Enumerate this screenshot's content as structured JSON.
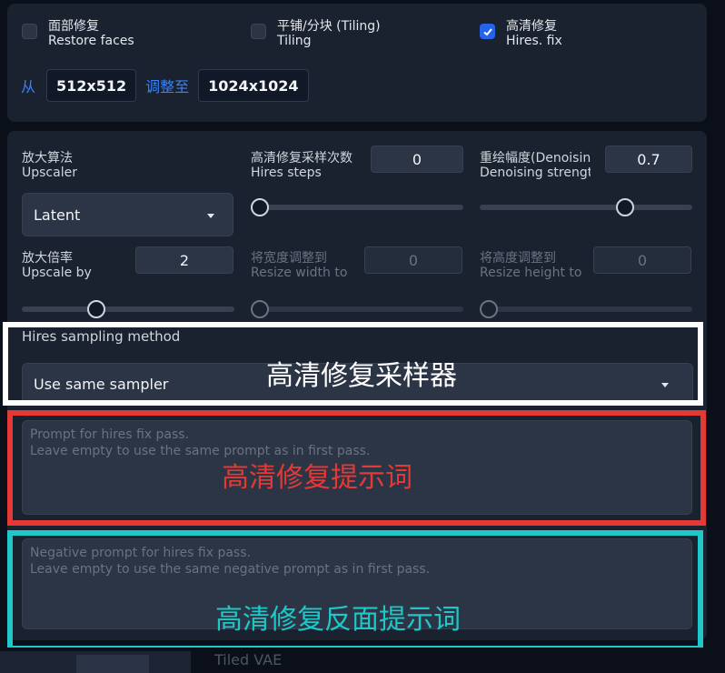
{
  "checkboxes": [
    {
      "zh": "面部修复",
      "en": "Restore faces",
      "checked": false
    },
    {
      "zh": "平铺/分块 (Tiling)",
      "en": "Tiling",
      "checked": false
    },
    {
      "zh": "高清修复",
      "en": "Hires. fix",
      "checked": true
    }
  ],
  "resize_info": {
    "from_label": "从",
    "from_value": "512x512",
    "to_label": "调整至",
    "to_value": "1024x1024"
  },
  "upscaler": {
    "zh": "放大算法",
    "en": "Upscaler",
    "selected": "Latent"
  },
  "hires_steps": {
    "zh": "高清修复采样次数",
    "en": "Hires steps",
    "value": "0",
    "slider_fraction": 0
  },
  "denoising": {
    "zh": "重绘幅度(Denoising",
    "en": "Denoising strength",
    "value": "0.7",
    "slider_fraction": 0.7
  },
  "upscale_by": {
    "zh": "放大倍率",
    "en": "Upscale by",
    "value": "2",
    "slider_fraction": 0.33
  },
  "resize_width": {
    "zh": "将宽度调整到",
    "en": "Resize width to",
    "value": "0",
    "slider_fraction": 0
  },
  "resize_height": {
    "zh": "将高度调整到",
    "en": "Resize height to",
    "value": "0",
    "slider_fraction": 0
  },
  "sampler": {
    "label": "Hires sampling method",
    "selected": "Use same sampler",
    "annotation": "高清修复采样器"
  },
  "hires_prompt": {
    "placeholder_line1": "Prompt for hires fix pass.",
    "placeholder_line2": "Leave empty to use the same prompt as in first pass.",
    "annotation": "高清修复提示词"
  },
  "hires_negative_prompt": {
    "placeholder_line1": "Negative prompt for hires fix pass.",
    "placeholder_line2": "Leave empty to use the same negative prompt as in first pass.",
    "annotation": "高清修复反面提示词"
  },
  "bottom": {
    "partial_label": "Tiled VAE"
  },
  "colors": {
    "annotation_white": "#ffffff",
    "annotation_red": "#e53935",
    "annotation_cyan": "#1ec8c8",
    "accent": "#2563eb"
  }
}
